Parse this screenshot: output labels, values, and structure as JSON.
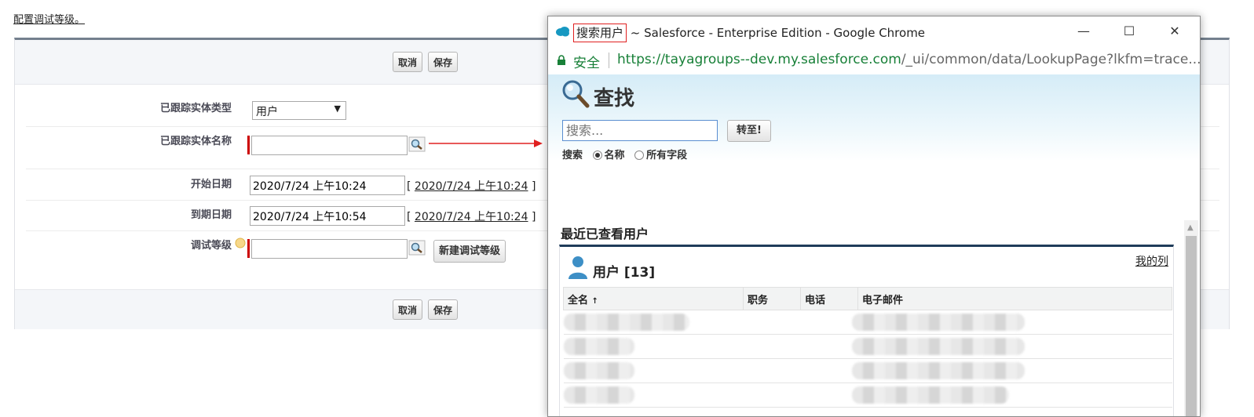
{
  "help_link": "配置调试等级。",
  "form": {
    "buttons": {
      "cancel": "取消",
      "save": "保存"
    },
    "fields": {
      "entity_type_label": "已跟踪实体类型",
      "entity_type_value": "用户",
      "entity_name_label": "已跟踪实体名称",
      "entity_name_value": "",
      "start_date_label": "开始日期",
      "start_date_value": "2020/7/24 上午10:24",
      "start_date_link": "2020/7/24 上午10:24",
      "end_date_label": "到期日期",
      "end_date_value": "2020/7/24 上午10:54",
      "end_date_link": "2020/7/24 上午10:24",
      "debug_level_label": "调试等级",
      "debug_level_value": "",
      "new_debug_level": "新建调试等级"
    }
  },
  "popup": {
    "title_highlight": "搜索用户",
    "title_rest": " ~ Salesforce - Enterprise Edition - Google Chrome",
    "controls": {
      "minimize": "—",
      "maximize": "☐",
      "close": "✕"
    },
    "secure": "安全",
    "url_domain": "https://tayagroups--dev.my.salesforce.com",
    "url_path": "/_ui/common/data/LookupPage?lkfm=trace...",
    "find_title": "查找",
    "search_placeholder": "搜索...",
    "go_button": "转至!",
    "search_label": "搜索",
    "option_name": "名称",
    "option_all": "所有字段",
    "recent_title": "最近已查看用户",
    "list_title": "用户 [13]",
    "my_list": "我的列",
    "columns": [
      "全名",
      "职务",
      "电话",
      "电子邮件"
    ],
    "sort_indicator": "↑"
  },
  "icons": [
    "salesforce-logo-icon",
    "lock-icon",
    "magnifier-icon",
    "lookup-icon",
    "help-icon",
    "user-icon"
  ],
  "colors": {
    "accent_blue": "#1f3c5a",
    "secure_green": "#188038",
    "required_red": "#cc0000",
    "annotation_red": "#e02020"
  }
}
